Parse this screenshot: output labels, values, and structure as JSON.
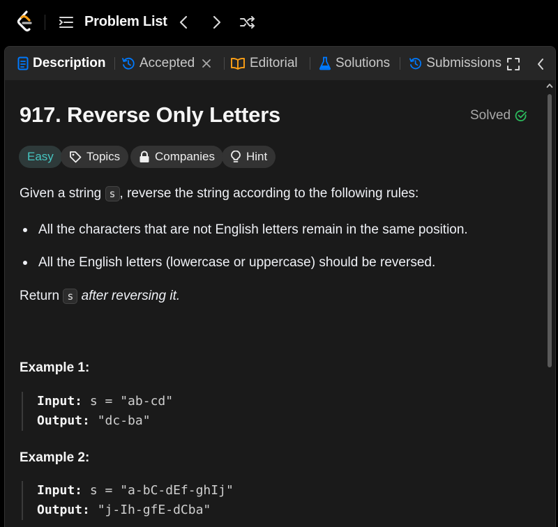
{
  "nav": {
    "title": "Problem List"
  },
  "tabs": [
    {
      "label": "Description",
      "icon": "description-icon"
    },
    {
      "label": "Accepted",
      "icon": "history-icon"
    },
    {
      "label": "Editorial",
      "icon": "book-icon"
    },
    {
      "label": "Solutions",
      "icon": "flask-icon"
    },
    {
      "label": "Submissions",
      "icon": "history-icon"
    }
  ],
  "problem": {
    "title": "917. Reverse Only Letters",
    "status": "Solved",
    "chips": {
      "difficulty": "Easy",
      "topics": "Topics",
      "companies": "Companies",
      "hint": "Hint"
    },
    "intro_before": "Given a string",
    "intro_code": "s",
    "intro_after": ", reverse the string according to the following rules:",
    "rules": [
      "All the characters that are not English letters remain in the same position.",
      "All the English letters (lowercase or uppercase) should be reversed."
    ],
    "return_before": "Return",
    "return_code": "s",
    "return_after": "after reversing it."
  },
  "examples": [
    {
      "title": "Example 1:",
      "input_label": "Input:",
      "input": "s = \"ab-cd\"",
      "output_label": "Output:",
      "output": "\"dc-ba\""
    },
    {
      "title": "Example 2:",
      "input_label": "Input:",
      "input": "s = \"a-bC-dEf-ghIj\"",
      "output_label": "Output:",
      "output": "\"j-Ih-gfE-dCba\""
    }
  ],
  "colors": {
    "easy": "#46c6c2",
    "solved_check": "#2cbb5d",
    "editorial_icon": "#ffa116",
    "solutions_icon": "#007aff",
    "history_icon": "#007aff"
  }
}
